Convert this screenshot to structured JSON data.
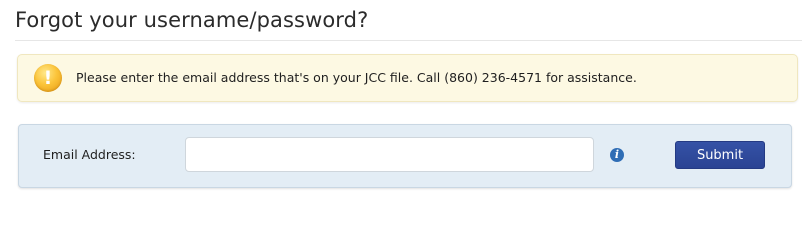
{
  "page": {
    "title": "Forgot your username/password?"
  },
  "notice": {
    "icon": "warning-icon",
    "icon_glyph": "!",
    "message": "Please enter the email address that's on your JCC file. Call (860) 236-4571 for assistance."
  },
  "form": {
    "email_label": "Email Address:",
    "email_value": "",
    "email_placeholder": "",
    "info_icon": "info-icon",
    "info_glyph": "i",
    "submit_label": "Submit"
  },
  "colors": {
    "notice_background": "#fdf9e3",
    "form_background": "#e3edf5",
    "submit_background": "#2f4a9c",
    "info_icon": "#2f6db5",
    "warning_icon": "#fbc43a"
  }
}
